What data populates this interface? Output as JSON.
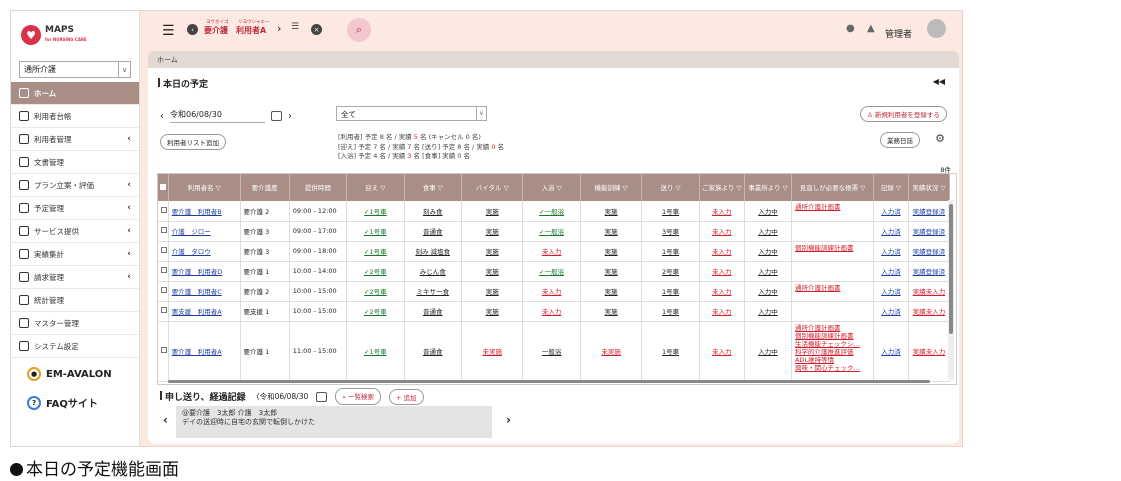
{
  "app": {
    "logo_name": "MAPS",
    "logo_sub": "for NURSING CARE"
  },
  "sidebar": {
    "service_select": "通所介護",
    "items": [
      {
        "label": "ホーム",
        "icon": "home-icon",
        "active": true,
        "arrow": false
      },
      {
        "label": "利用者台帳",
        "icon": "person-icon",
        "active": false,
        "arrow": false
      },
      {
        "label": "利用者管理",
        "icon": "card-icon",
        "active": false,
        "arrow": true
      },
      {
        "label": "文書管理",
        "icon": "folder-icon",
        "active": false,
        "arrow": false
      },
      {
        "label": "プラン立案・評価",
        "icon": "pen-icon",
        "active": false,
        "arrow": true
      },
      {
        "label": "予定管理",
        "icon": "calendar-icon",
        "active": false,
        "arrow": true
      },
      {
        "label": "サービス提供",
        "icon": "people-icon",
        "active": false,
        "arrow": true
      },
      {
        "label": "実績集計",
        "icon": "chart-icon",
        "active": false,
        "arrow": true
      },
      {
        "label": "請求管理",
        "icon": "invoice-icon",
        "active": false,
        "arrow": true
      },
      {
        "label": "統計管理",
        "icon": "stats-icon",
        "active": false,
        "arrow": false
      },
      {
        "label": "マスター管理",
        "icon": "gear-icon",
        "active": false,
        "arrow": false
      },
      {
        "label": "システム設定",
        "icon": "wrench-icon",
        "active": false,
        "arrow": false
      }
    ],
    "link_avalon": "EM-AVALON",
    "link_faq": "FAQサイト"
  },
  "header": {
    "care_level": "要介護",
    "care_level_ruby": "ヨウカイゴ",
    "user_name": "利用者A",
    "user_name_ruby": "リヨウシャエー",
    "admin_label": "管理者"
  },
  "breadcrumb": "ホーム",
  "schedule": {
    "title": "本日の予定",
    "date": "令和06/08/30",
    "filter": "全て",
    "add_list_button": "利用者リスト追加",
    "register_button": "新規利用者を登録する",
    "diary_button": "業務日誌",
    "summary": [
      {
        "pre": "[利用者] 予定 8 名 / 実績 ",
        "red": "5",
        "post": " 名 (キャンセル 0 名)"
      },
      {
        "pre": "[迎え] 予定 7 名 / 実績 7 名  [送り] 予定 8 名 / 実績 ",
        "red": "0",
        "post": " 名"
      },
      {
        "pre": "[入浴] 予定 4 名 / 実績 ",
        "red": "3",
        "post": " 名  [食事] 実績 0 名"
      }
    ],
    "count": "8件",
    "columns": [
      "利用者名",
      "要介護度",
      "提供時間",
      "迎え",
      "食事",
      "バイタル",
      "入浴",
      "機能訓練",
      "送り",
      "ご家族より",
      "事業所より",
      "見直しが必要な帳票",
      "記録",
      "実績状況"
    ],
    "rows": [
      {
        "name": "要介護　利用者B",
        "level": "要介護 2",
        "time": "09:00 - 12:00",
        "pickup": "✓1号車",
        "meal": "刻み食",
        "vital": "実施",
        "bath": "✓一般浴",
        "training": "実施",
        "dropoff": "1号車",
        "family": "未入力",
        "office": "入力中",
        "forms": [
          "通所介護計画書"
        ],
        "record": "入力済",
        "status": "実績登録済"
      },
      {
        "name": "介護　ジロー",
        "level": "要介護 3",
        "time": "09:00 - 17:00",
        "pickup": "✓1号車",
        "meal": "普通食",
        "vital": "実施",
        "bath": "✓一般浴",
        "training": "実施",
        "dropoff": "3号車",
        "family": "未入力",
        "office": "入力中",
        "forms": [],
        "record": "入力済",
        "status": "実績登録済"
      },
      {
        "name": "介護　タロウ",
        "level": "要介護 3",
        "time": "09:00 - 18:00",
        "pickup": "✓1号車",
        "meal": "刻み 減塩食",
        "vital": "実施",
        "bath": "未入力",
        "training": "実施",
        "dropoff": "1号車",
        "family": "未入力",
        "office": "入力中",
        "forms": [
          "個別機能訓練計画書"
        ],
        "record": "入力済",
        "status": "実績登録済"
      },
      {
        "name": "要介護　利用者D",
        "level": "要介護 1",
        "time": "10:00 - 14:00",
        "pickup": "✓2号車",
        "meal": "みじん食",
        "vital": "実施",
        "bath": "✓一般浴",
        "training": "実施",
        "dropoff": "2号車",
        "family": "未入力",
        "office": "入力中",
        "forms": [],
        "record": "入力済",
        "status": "実績登録済"
      },
      {
        "name": "要介護　利用者C",
        "level": "要介護 2",
        "time": "10:00 - 15:00",
        "pickup": "✓2号車",
        "meal": "ミキサー食",
        "vital": "実施",
        "bath": "未入力",
        "training": "実施",
        "dropoff": "1号車",
        "family": "未入力",
        "office": "入力中",
        "forms": [
          "通所介護計画書"
        ],
        "record": "入力済",
        "status": "実績未入力"
      },
      {
        "name": "要支援　利用者A",
        "level": "要支援 1",
        "time": "10:00 - 15:00",
        "pickup": "✓2号車",
        "meal": "普通食",
        "vital": "実施",
        "bath": "未入力",
        "training": "実施",
        "dropoff": "1号車",
        "family": "未入力",
        "office": "入力中",
        "forms": [],
        "record": "入力済",
        "status": "実績未入力"
      },
      {
        "name": "要介護　利用者A",
        "level": "要介護 1",
        "time": "11:00 - 15:00",
        "pickup": "✓1号車",
        "meal": "普通食",
        "vital": "未実施",
        "bath": "一般浴",
        "training": "未実施",
        "dropoff": "1号車",
        "family": "未入力",
        "office": "入力中",
        "forms": [
          "通所介護計画書",
          "個別機能訓練計画書",
          "生活機能チェックシ…",
          "科学的介護推進評価",
          "ADL維持等情",
          "興味・関心チェック…"
        ],
        "record": "入力済",
        "status": "実績未入力"
      }
    ]
  },
  "notes": {
    "title": "申し送り、経過記録",
    "date": "(令和06/08/30",
    "search_button": "一覧検索",
    "add_button": "追加",
    "entry_header": "@要介護　3太郎 介護　3太郎",
    "entry_body": "デイの送迎時に自宅の玄関で転倒しかけた"
  },
  "caption": "本日の予定機能画面",
  "colors": {
    "accent": "#a88e85",
    "brand": "#d8334a",
    "alert": "#d0202d",
    "link": "#1f3f9e"
  }
}
